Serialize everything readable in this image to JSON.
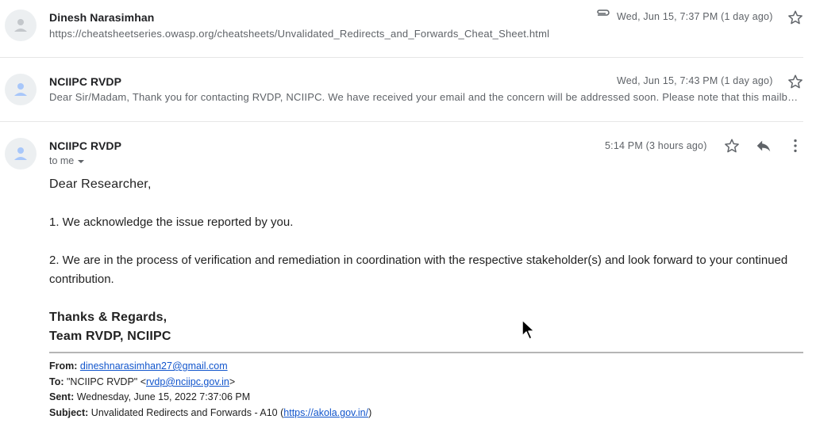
{
  "messages": [
    {
      "sender": "Dinesh Narasimhan",
      "snippet": "https://cheatsheetseries.owasp.org/cheatsheets/Unvalidated_Redirects_and_Forwards_Cheat_Sheet.html",
      "date": "Wed, Jun 15, 7:37 PM (1 day ago)",
      "has_attachment": true
    },
    {
      "sender": "NCIIPC RVDP",
      "snippet": "Dear Sir/Madam, Thank you for contacting RVDP, NCIIPC. We have received your email and the concern will be addressed soon. Please note that this mailbox is not monitored...",
      "date": "Wed, Jun 15, 7:43 PM (1 day ago)"
    }
  ],
  "open_message": {
    "sender": "NCIIPC RVDP",
    "to_label": "to me",
    "date": "5:14 PM (3 hours ago)",
    "greeting": "Dear Researcher,",
    "point1": "1. We acknowledge the issue reported by you.",
    "point2": "2. We are in the process of verification and remediation in coordination with the respective stakeholder(s) and look forward to your continued contribution.",
    "signoff": "Thanks & Regards,",
    "team": "Team RVDP, NCIIPC",
    "quoted": {
      "from_label": "From:",
      "from_email": "dineshnarasimhan27@gmail.com",
      "to_label": "To:",
      "to_name": "\"NCIIPC RVDP\" <",
      "to_email": "rvdp@nciipc.gov.in",
      "to_close": ">",
      "sent_label": "Sent:",
      "sent_value": "Wednesday, June 15, 2022 7:37:06 PM",
      "subject_label": "Subject:",
      "subject_value": "Unvalidated Redirects and Forwards - A10 (",
      "subject_link": "https://akola.gov.in/",
      "subject_close": ")"
    }
  },
  "icons": {
    "avatar": "person-icon",
    "attachment": "paperclip-icon",
    "star": "star-icon",
    "reply": "reply-icon",
    "more": "more-vert-icon"
  },
  "colors": {
    "link": "#1155cc",
    "muted": "#5f6368",
    "avatar_bg": "#eceff1"
  }
}
